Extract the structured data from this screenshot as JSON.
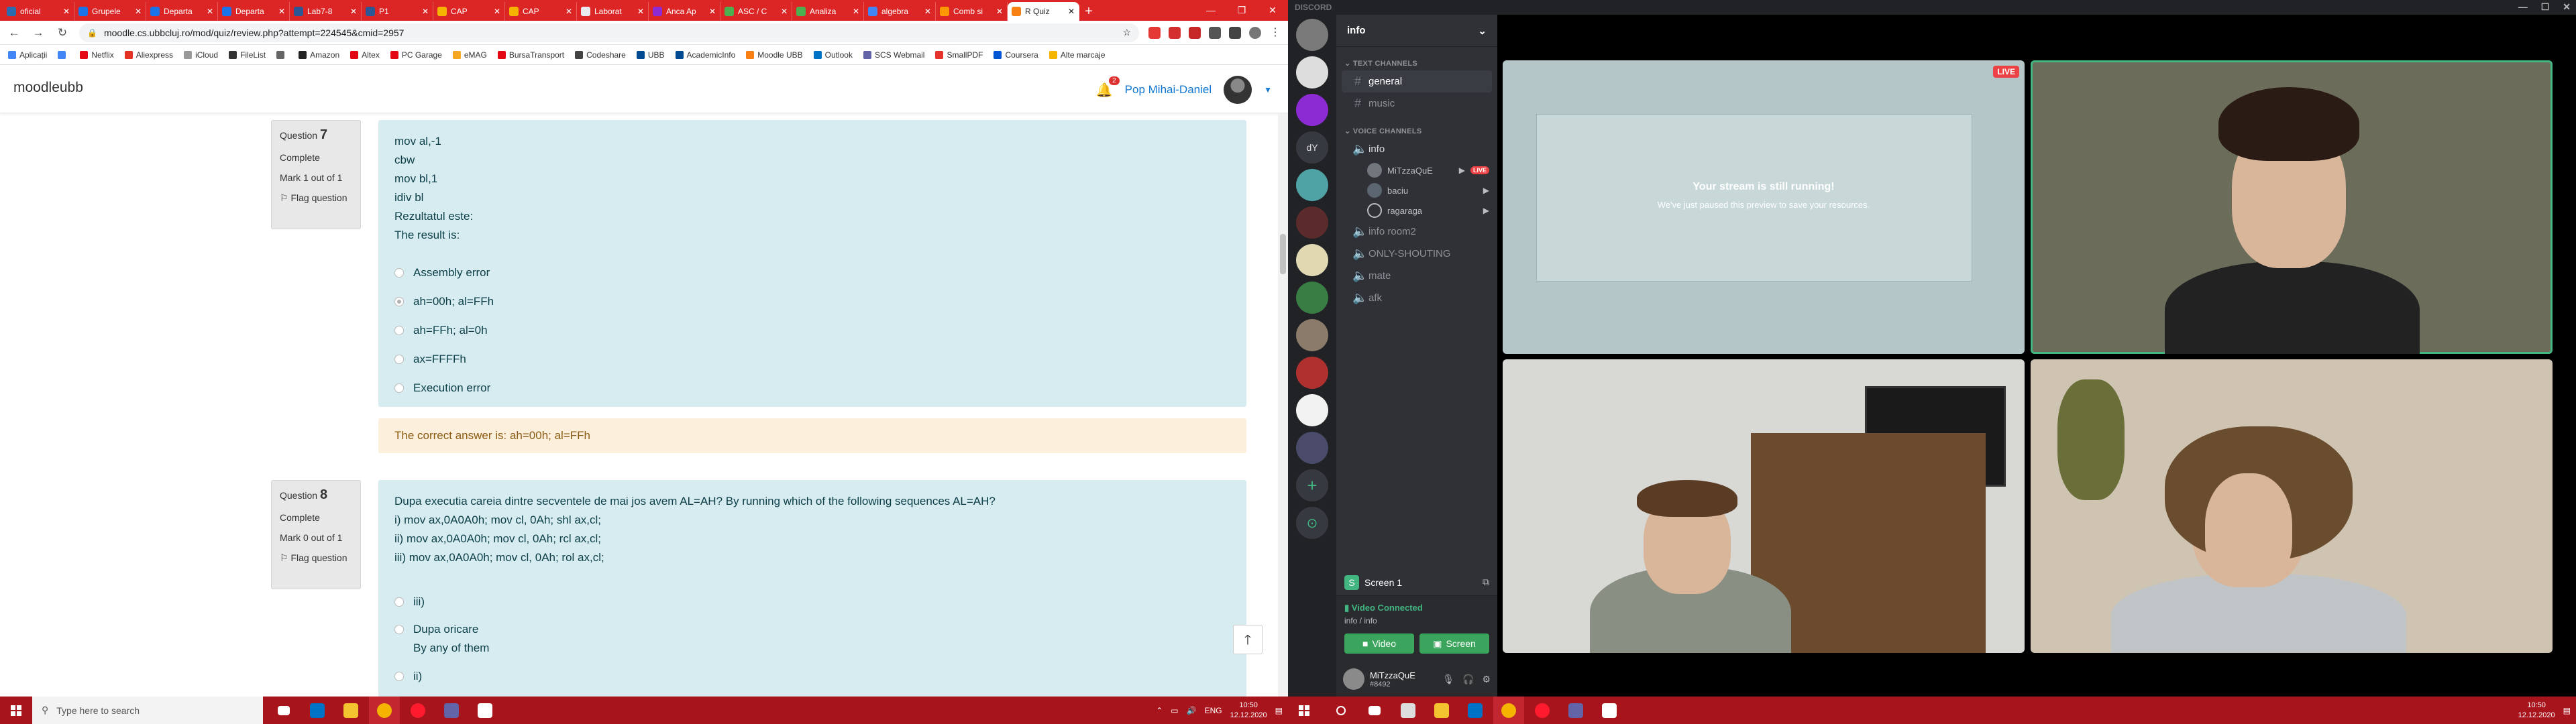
{
  "browser": {
    "tabs": [
      {
        "label": "oficial",
        "color": "#2b6cb0"
      },
      {
        "label": "Grupele",
        "color": "#1a73e8"
      },
      {
        "label": "Departa",
        "color": "#1a73e8"
      },
      {
        "label": "Departa",
        "color": "#1a73e8"
      },
      {
        "label": "Lab7-8",
        "color": "#2b5797"
      },
      {
        "label": "P1",
        "color": "#2b5797"
      },
      {
        "label": "CAP",
        "color": "#f4b400"
      },
      {
        "label": "CAP",
        "color": "#f4b400"
      },
      {
        "label": "Laborat",
        "color": "#e8eaed"
      },
      {
        "label": "Anca Ap",
        "color": "#8c2ad4"
      },
      {
        "label": "ASC / C",
        "color": "#4caf50"
      },
      {
        "label": "Analiza",
        "color": "#4caf50"
      },
      {
        "label": "algebra",
        "color": "#4285f4"
      },
      {
        "label": "Comb si",
        "color": "#ff9800"
      },
      {
        "label": "R Quiz",
        "color": "#f98012",
        "active": true
      }
    ],
    "url": "moodle.cs.ubbcluj.ro/mod/quiz/review.php?attempt=224545&cmid=2957",
    "bookmarks": [
      {
        "label": "Aplicații",
        "color": "#4285f4"
      },
      {
        "label": "",
        "color": "#4285f4"
      },
      {
        "label": "Netflix",
        "color": "#e50914"
      },
      {
        "label": "Aliexpress",
        "color": "#e43225"
      },
      {
        "label": "iCloud",
        "color": "#999999"
      },
      {
        "label": "FileList",
        "color": "#333333"
      },
      {
        "label": "",
        "color": "#666666"
      },
      {
        "label": "Amazon",
        "color": "#222222"
      },
      {
        "label": "Altex",
        "color": "#e30613"
      },
      {
        "label": "PC Garage",
        "color": "#e30613"
      },
      {
        "label": "eMAG",
        "color": "#f5a623"
      },
      {
        "label": "BursaTransport",
        "color": "#e30613"
      },
      {
        "label": "Codeshare",
        "color": "#444444"
      },
      {
        "label": "UBB",
        "color": "#004a8f"
      },
      {
        "label": "AcademicInfo",
        "color": "#004a8f"
      },
      {
        "label": "Moodle UBB",
        "color": "#f98012"
      },
      {
        "label": "Outlook",
        "color": "#0072c6"
      },
      {
        "label": "SCS Webmail",
        "color": "#6264a7"
      },
      {
        "label": "SmallPDF",
        "color": "#e5322d"
      },
      {
        "label": "Coursera",
        "color": "#0056d2"
      },
      {
        "label": "Alte marcaje",
        "color": "#f4b400"
      }
    ]
  },
  "moodle": {
    "brand": "moodleubb",
    "notifications_count": "2",
    "username": "Pop Mihai-Daniel",
    "question7": {
      "label": "Question",
      "number": "7",
      "status": "Complete",
      "mark": "Mark 1 out of 1",
      "flag": "Flag question",
      "text_lines": [
        "mov al,-1",
        "cbw",
        "mov bl,1",
        "idiv bl",
        "Rezultatul este:",
        "The result is:"
      ],
      "answers": [
        "Assembly error",
        "ah=00h; al=FFh",
        "ah=FFh; al=0h",
        "ax=FFFFh",
        "Execution error"
      ],
      "feedback": "The correct answer is: ah=00h; al=FFh"
    },
    "question8": {
      "label": "Question",
      "number": "8",
      "status": "Complete",
      "mark": "Mark 0 out of 1",
      "flag": "Flag question",
      "text_lines": [
        "Dupa executia careia dintre secventele de mai jos avem AL=AH? By running which of the following sequences AL=AH?",
        "i) mov ax,0A0A0h; mov cl, 0Ah; shl ax,cl;",
        "ii) mov ax,0A0A0h; mov cl, 0Ah; rcl ax,cl;",
        "iii) mov ax,0A0A0h; mov cl, 0Ah; rol ax,cl;"
      ],
      "answers": [
        "iii)",
        "Dupa oricare",
        "By any of them",
        "ii)"
      ]
    }
  },
  "taskbar_left": {
    "search_placeholder": "Type here to search",
    "lang": "ENG",
    "time": "10:50",
    "date": "12.12.2020"
  },
  "discord": {
    "app_title": "DISCORD",
    "server_name": "info",
    "text_category": "TEXT CHANNELS",
    "text_channels": [
      "general",
      "music"
    ],
    "voice_category": "VOICE CHANNELS",
    "voice_channels": [
      "info",
      "info room2",
      "ONLY-SHOUTING",
      "mate",
      "afk"
    ],
    "voice_users": [
      {
        "name": "MiTzzaQuE",
        "live": "LIVE"
      },
      {
        "name": "baciu",
        "live": ""
      },
      {
        "name": "ragaraga",
        "live": ""
      }
    ],
    "guild_initials": "dY",
    "screen_label": "Screen 1",
    "voice_connected": "Video Connected",
    "voice_location": "info / info",
    "btn_video": "Video",
    "btn_screen": "Screen",
    "self_name": "MiTzzaQuE",
    "self_tag": "#8492",
    "stream_title": "Your stream is still running!",
    "stream_sub": "We've just paused this preview to save your resources.",
    "live_badge": "LIVE"
  },
  "taskbar_right": {
    "time": "10:50",
    "date": "12.12.2020"
  }
}
